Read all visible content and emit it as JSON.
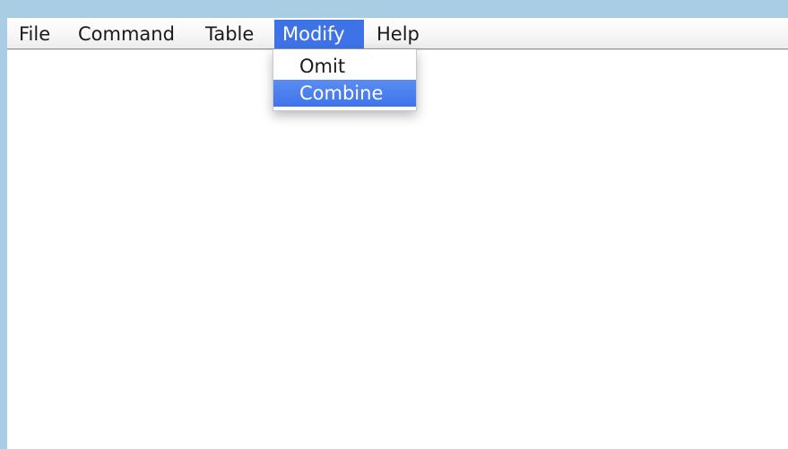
{
  "menubar": {
    "items": [
      {
        "label": "File"
      },
      {
        "label": "Command"
      },
      {
        "label": "Table"
      },
      {
        "label": "Modify",
        "active": true
      },
      {
        "label": "Help"
      }
    ]
  },
  "dropdown": {
    "parent": "Modify",
    "items": [
      {
        "label": "Omit",
        "highlighted": false
      },
      {
        "label": "Combine",
        "highlighted": true
      }
    ]
  },
  "colors": {
    "desktop_background": "#a9cde2",
    "selection": "#3e73e8",
    "window_background": "#ffffff"
  }
}
